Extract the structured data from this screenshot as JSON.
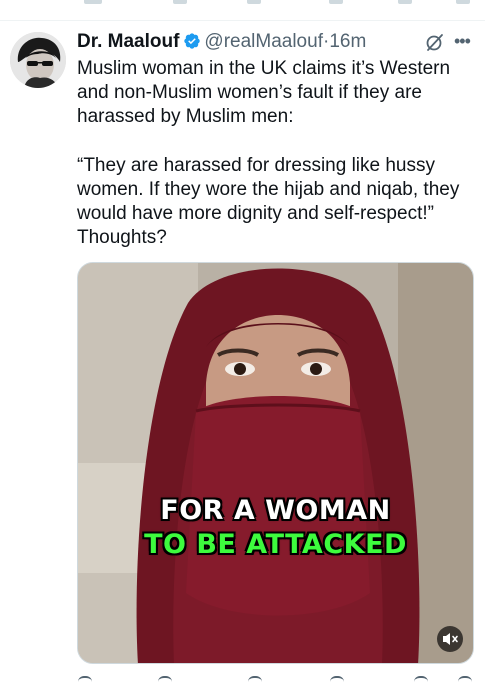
{
  "tweet": {
    "author_name": "Dr. Maalouf",
    "handle": "@realMaalouf",
    "separator": "·",
    "time": "16m",
    "verified_color": "#1d9bf0",
    "paragraph_1": "Muslim woman in the UK claims it’s Western and non-Muslim women’s fault if they are harassed by Muslim men:",
    "paragraph_2": "“They are harassed for dressing like hussy women. If they wore the hijab and niqab, they would have more dignity and self-respect!” Thoughts?",
    "icons": [
      "grok-icon",
      "more-icon",
      "verified-badge-icon",
      "mute-icon"
    ]
  },
  "video": {
    "caption_line_1": "FOR A WOMAN",
    "caption_line_2": "TO BE ATTACKED",
    "caption_colors": [
      "#ffffff",
      "#3dfb3d"
    ]
  }
}
